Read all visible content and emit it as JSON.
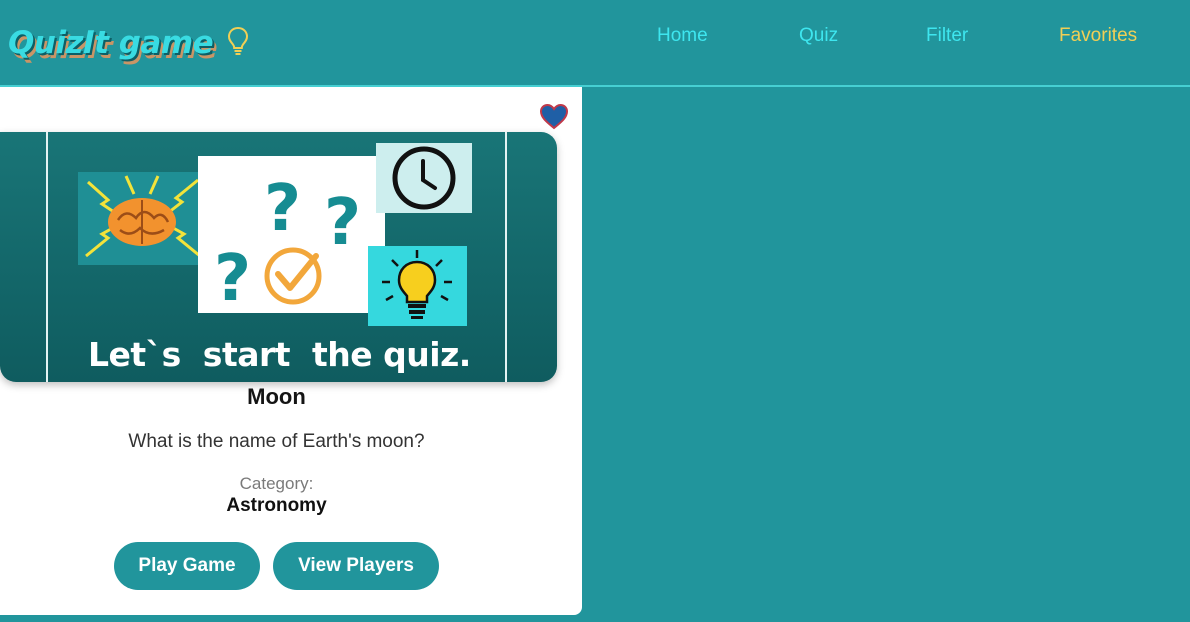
{
  "brand": {
    "name": "QuizIt game",
    "icon": "lightbulb-icon"
  },
  "nav": {
    "items": [
      {
        "label": "Home",
        "active": false
      },
      {
        "label": "Quiz",
        "active": false
      },
      {
        "label": "Filter",
        "active": false
      },
      {
        "label": "Favorites",
        "active": true
      }
    ]
  },
  "card": {
    "favorite_icon": "heart-icon",
    "banner_caption": "Let`s  start  the quiz.",
    "title": "Moon",
    "question": "What is the name of Earth's moon?",
    "category_label": "Category:",
    "category_value": "Astronomy",
    "buttons": {
      "play": "Play Game",
      "players": "View Players"
    }
  },
  "colors": {
    "primary": "#21959c",
    "accent": "#f1cf55",
    "nav_text": "#3ee6ef",
    "heart": "#1f5fa6"
  }
}
